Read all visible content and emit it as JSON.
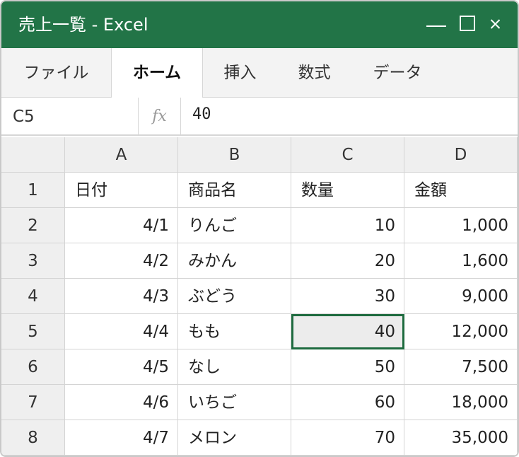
{
  "window": {
    "title": "売上一覧 - Excel"
  },
  "ribbon": {
    "tabs": [
      "ファイル",
      "ホーム",
      "挿入",
      "数式",
      "データ"
    ],
    "active_tab": "ホーム"
  },
  "formula_bar": {
    "name_box": "C5",
    "fx_label": "fx",
    "value": "40"
  },
  "sheet": {
    "columns": [
      "A",
      "B",
      "C",
      "D"
    ],
    "row_numbers": [
      "1",
      "2",
      "3",
      "4",
      "5",
      "6",
      "7",
      "8"
    ],
    "header_row": [
      "日付",
      "商品名",
      "数量",
      "金額"
    ],
    "rows": [
      [
        "4/1",
        "りんご",
        "10",
        "1,000"
      ],
      [
        "4/2",
        "みかん",
        "20",
        "1,600"
      ],
      [
        "4/3",
        "ぶどう",
        "30",
        "9,000"
      ],
      [
        "4/4",
        "もも",
        "40",
        "12,000"
      ],
      [
        "4/5",
        "なし",
        "50",
        "7,500"
      ],
      [
        "4/6",
        "いちご",
        "60",
        "18,000"
      ],
      [
        "4/7",
        "メロン",
        "70",
        "35,000"
      ]
    ],
    "selected_cell": "C5"
  },
  "colors": {
    "title_bar": "#227447",
    "selection_border": "#1e6b3f",
    "header_bg": "#efefef"
  }
}
